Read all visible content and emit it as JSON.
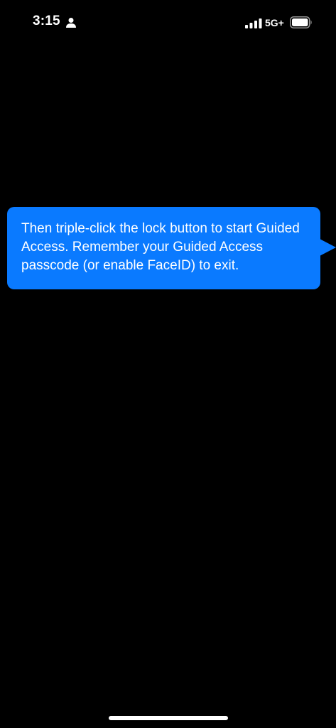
{
  "status_bar": {
    "time": "3:15",
    "network": "5G+",
    "icons": {
      "person": "person-icon",
      "signal": "cellular-signal-icon",
      "battery": "battery-icon"
    }
  },
  "bubble": {
    "text": "Then triple-click the lock button to start Guided Access. Remember your Guided Access passcode (or enable FaceID) to exit.",
    "color": "#0a7aff"
  },
  "colors": {
    "background": "#000000",
    "text": "#ffffff"
  }
}
